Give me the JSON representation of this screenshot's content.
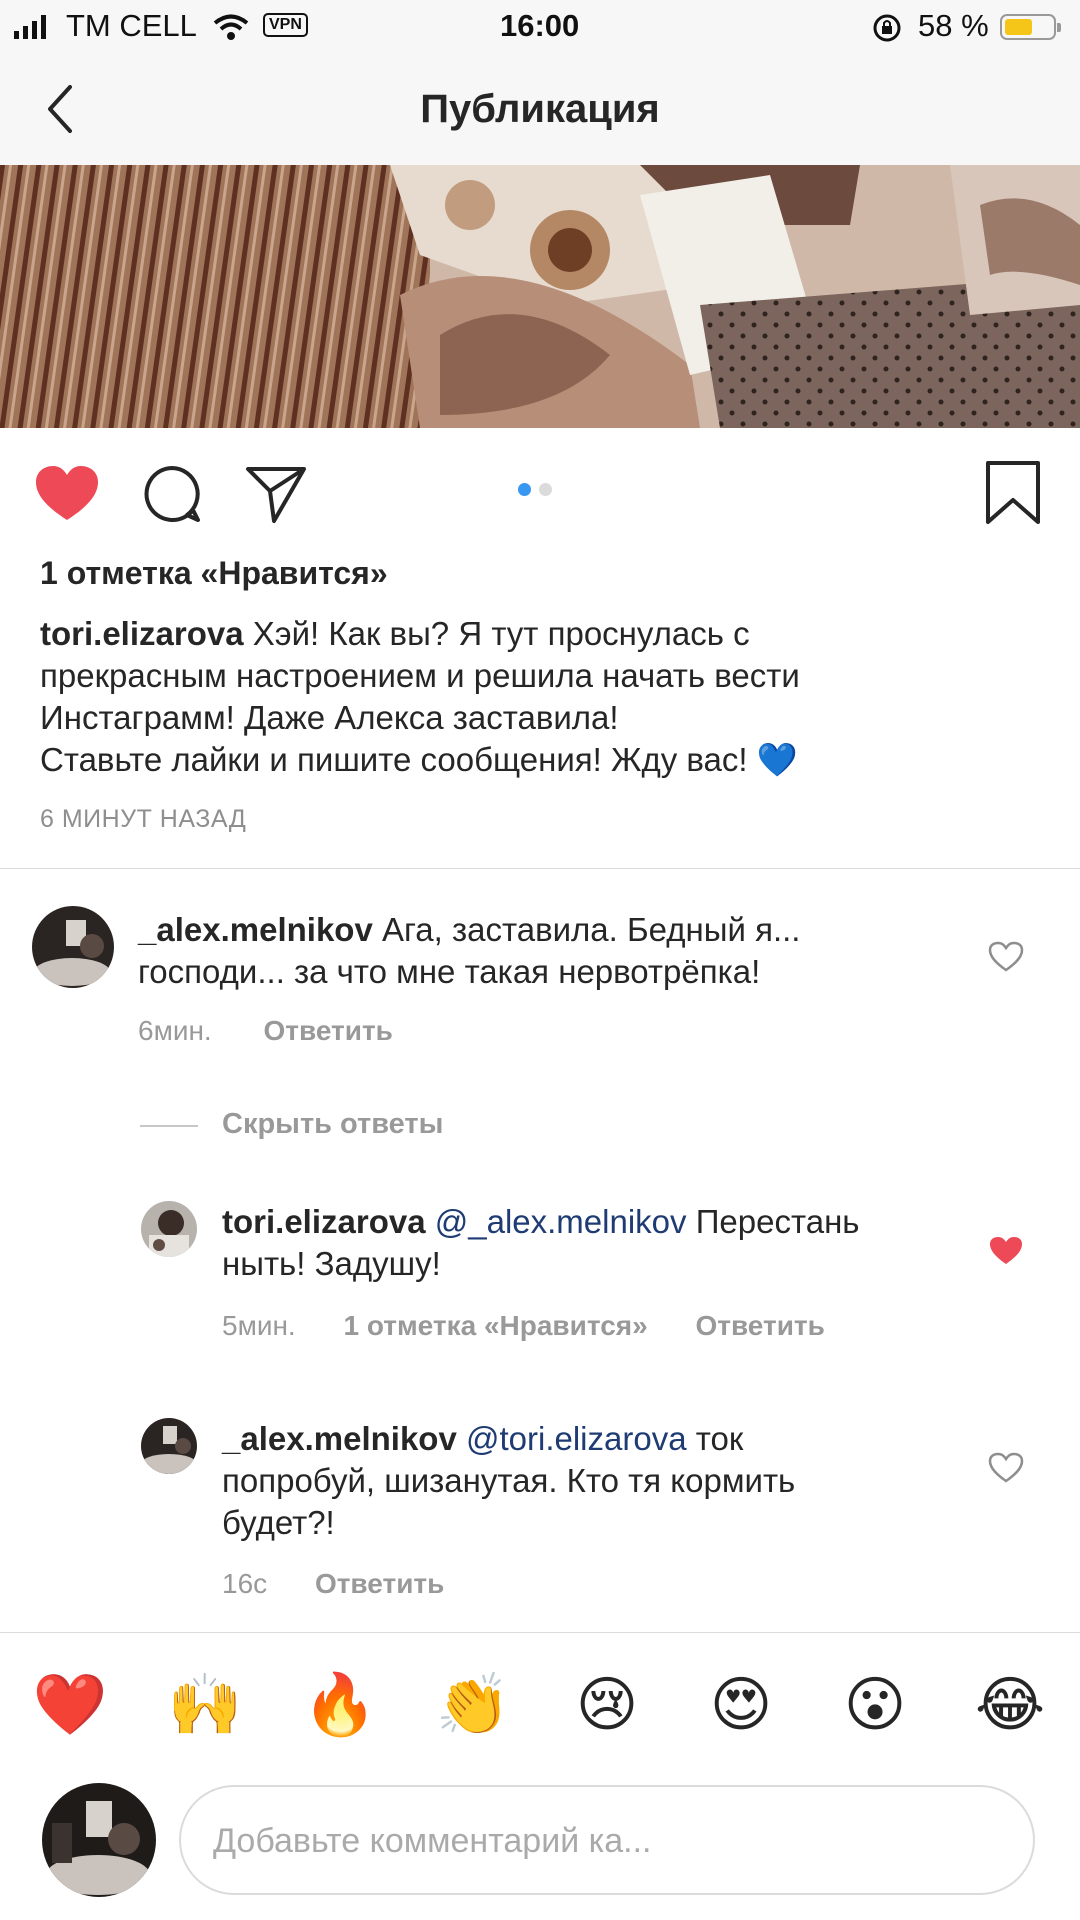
{
  "status_bar": {
    "carrier": "TM CELL",
    "vpn": "VPN",
    "time": "16:00",
    "battery_percent": "58 %",
    "battery_level": 0.58
  },
  "header": {
    "title": "Публикация"
  },
  "post": {
    "likes_text": "1 отметка «Нравится»",
    "author": "tori.elizarova",
    "caption_lines": [
      "Хэй! Как вы? Я тут проснулась с",
      "прекрасным настроением и решила начать вести",
      "Инстаграмм! Даже Алекса заставила!",
      "Ставьте лайки и пишите сообщения! Жду вас!"
    ],
    "caption_emoji": "💙",
    "time_ago": "6 МИНУТ НАЗАД",
    "carousel_count": 2,
    "carousel_active": 1,
    "liked": true
  },
  "comments": [
    {
      "user": "_alex.melnikov",
      "text_lines": [
        "Ага, заставила. Бедный я...",
        "господи... за что мне такая нервотрёпка!"
      ],
      "time": "6мин.",
      "reply_label": "Ответить",
      "liked": false
    }
  ],
  "hide_replies": "Скрыть ответы",
  "replies": [
    {
      "user": "tori.elizarova",
      "mention": "@_alex.melnikov",
      "text_line1": "Перестань",
      "text_line2": "ныть! Задушу!",
      "time": "5мин.",
      "likes": "1 отметка «Нравится»",
      "reply_label": "Ответить",
      "liked": true
    },
    {
      "user": "_alex.melnikov",
      "mention": "@tori.elizarova",
      "text_line1": "ток",
      "text_line2": "попробуй, шизанутая. Кто тя кормить",
      "text_line3": "будет?!",
      "time": "16с",
      "reply_label": "Ответить",
      "liked": false
    }
  ],
  "emoji_bar": [
    "❤️",
    "🙌",
    "🔥",
    "👏",
    "😢",
    "😍",
    "😮",
    "😂"
  ],
  "comment_input": {
    "placeholder": "Добавьте комментарий ка..."
  },
  "colors": {
    "like_red": "#ed4956",
    "mention_blue": "#1f3b73",
    "carousel_active": "#3897f0",
    "header_bg": "#f7f7f7"
  }
}
